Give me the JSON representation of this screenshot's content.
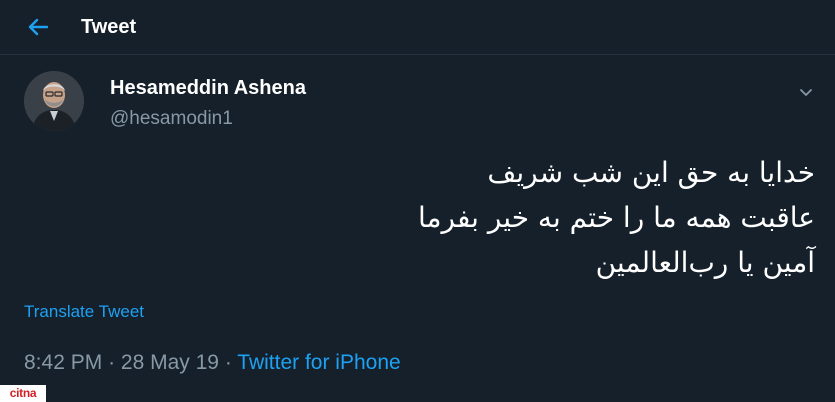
{
  "header": {
    "title": "Tweet",
    "back_icon": "arrow-left-icon"
  },
  "tweet": {
    "author": {
      "name": "Hesameddin Ashena",
      "handle": "@hesamodin1",
      "avatar_icon": "avatar"
    },
    "menu_icon": "chevron-down-icon",
    "text_lines": [
      "خدایا به حق این شب شریف",
      "عاقبت همه ما را ختم به خیر بفرما",
      "آمین یا رب‌العالمین"
    ],
    "translate_label": "Translate Tweet",
    "time": "8:42 PM",
    "separator": "·",
    "date": "28 May 19",
    "source": "Twitter for iPhone"
  },
  "watermark": {
    "text": "citna"
  },
  "colors": {
    "background": "#15202b",
    "accent": "#1da1f2",
    "secondary_text": "#8899a6",
    "divider": "#253341"
  }
}
